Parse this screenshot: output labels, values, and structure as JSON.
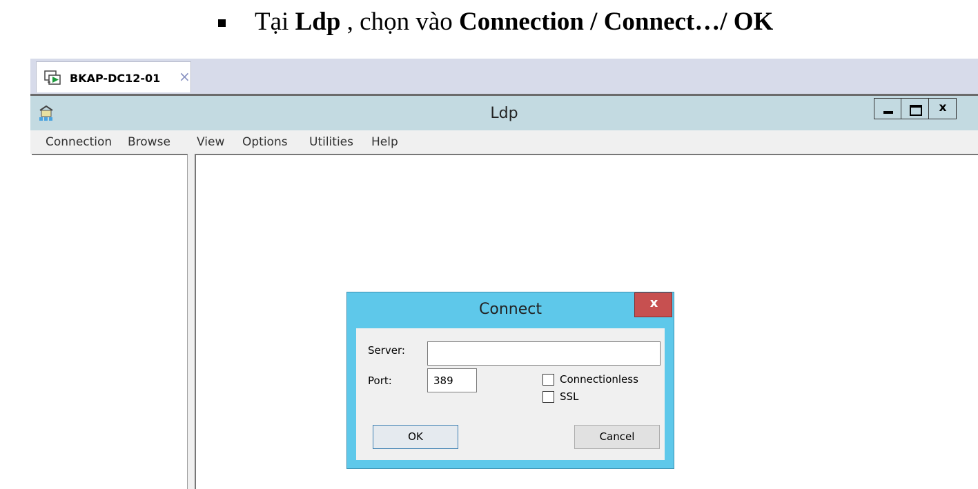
{
  "instruction": {
    "prefix": "Tại ",
    "app": "Ldp",
    "middle": " , chọn vào ",
    "path": "Connection / Connect…/ OK"
  },
  "vm_tab": {
    "label": "BKAP-DC12-01",
    "close_glyph": "×",
    "icon": "remote-computer-icon"
  },
  "window": {
    "title": "Ldp",
    "app_icon": "ldp-app-icon",
    "buttons": {
      "minimize": "minimize-icon",
      "maximize": "maximize-icon",
      "close_glyph": "x"
    }
  },
  "menu": [
    "Connection",
    "Browse",
    "View",
    "Options",
    "Utilities",
    "Help"
  ],
  "dialog": {
    "title": "Connect",
    "close_glyph": "x",
    "server_label": "Server:",
    "server_value": "",
    "port_label": "Port:",
    "port_value": "389",
    "connectionless_label": "Connectionless",
    "connectionless_checked": false,
    "ssl_label": "SSL",
    "ssl_checked": false,
    "ok_label": "OK",
    "cancel_label": "Cancel"
  },
  "colors": {
    "tabstrip": "#d7dbea",
    "titlebar": "#c3dae1",
    "dialog_frame": "#5ec8ea",
    "dialog_close": "#c75050",
    "menubar": "#f0f0f0"
  }
}
